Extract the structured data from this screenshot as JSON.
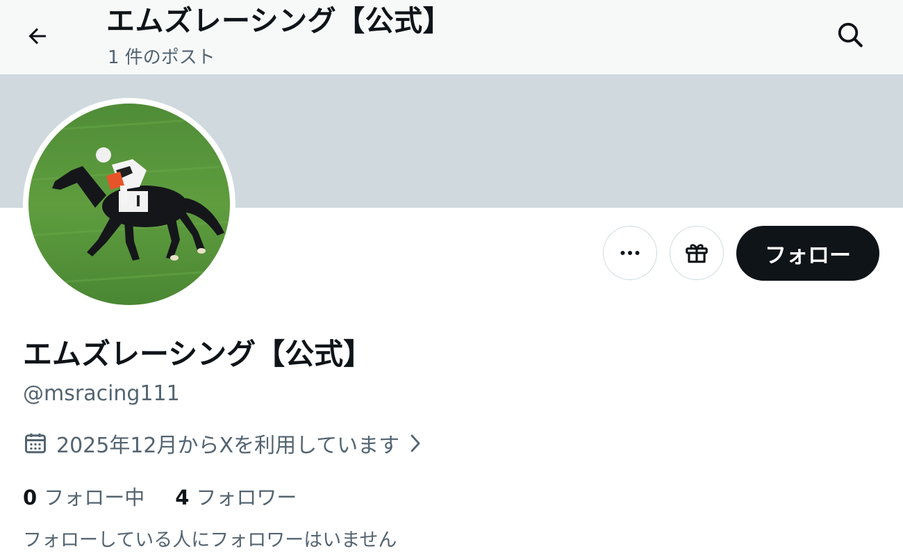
{
  "header": {
    "title": "エムズレーシング【公式】",
    "post_count": "1 件のポスト",
    "back_icon": "arrow-left-icon",
    "search_icon": "search-icon"
  },
  "profile": {
    "display_name": "エムズレーシング【公式】",
    "handle": "@msracing111",
    "joined": "2025年12月からXを利用しています",
    "following_count": "0",
    "following_label": "フォロー中",
    "followers_count": "4",
    "followers_label": "フォロワー",
    "mutual_note": "フォローしている人にフォロワーはいません"
  },
  "actions": {
    "more_icon": "more-icon",
    "gift_icon": "gift-icon",
    "follow_label": "フォロー"
  },
  "colors": {
    "banner": "#cfd9de",
    "primary_text": "#0f1419",
    "secondary_text": "#536471",
    "follow_button": "#0f1419",
    "header_bg": "#f7f9f9"
  }
}
